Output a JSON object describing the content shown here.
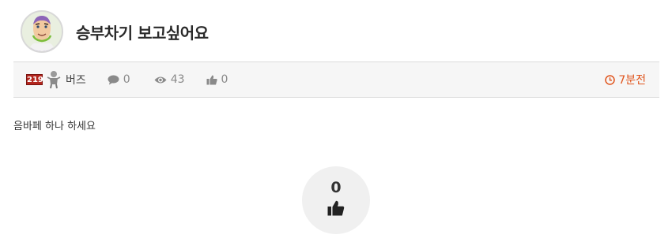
{
  "post": {
    "title": "승부차기 보고싶어요",
    "body": "음바페 하나 하세요"
  },
  "meta": {
    "level_badge": "219",
    "author": "버즈",
    "comments": "0",
    "views": "43",
    "likes": "0",
    "time": "7분전"
  },
  "vote": {
    "count": "0"
  },
  "colors": {
    "accent": "#e0541c",
    "badge": "#b3261e",
    "meta_bg": "#f6f6f6"
  },
  "icons": {
    "avatar": "buzz-lightyear-avatar",
    "comment": "comment-icon",
    "views": "eye-icon",
    "likes": "thumbs-up-icon",
    "time": "clock-icon"
  }
}
